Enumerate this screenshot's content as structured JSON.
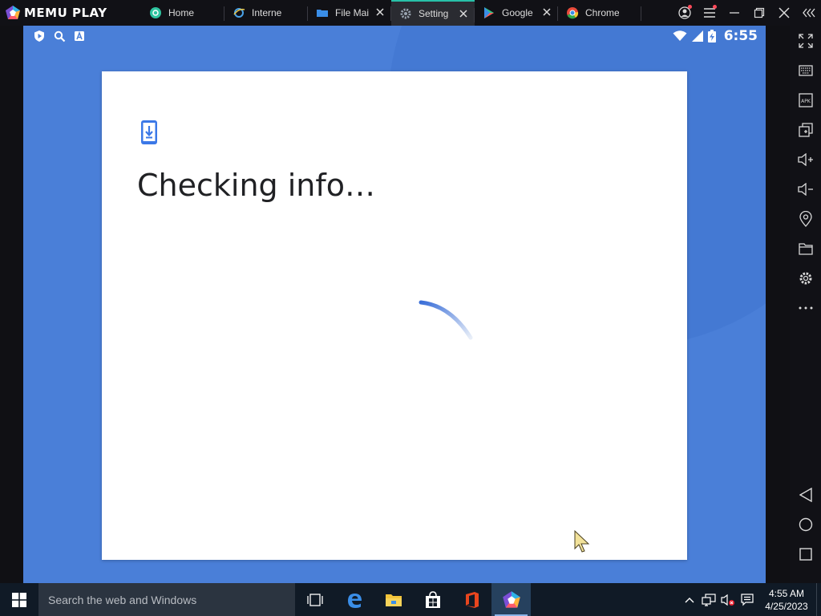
{
  "app": {
    "name": "MEMU PLAY"
  },
  "tabs": [
    {
      "label": "Home",
      "icon": "memu-home-icon",
      "active": false,
      "closable": false
    },
    {
      "label": "Interne",
      "icon": "internet-icon",
      "active": false,
      "closable": false
    },
    {
      "label": "File Mai",
      "icon": "folder-icon",
      "active": false,
      "closable": true
    },
    {
      "label": "Setting",
      "icon": "settings-icon",
      "active": true,
      "closable": true
    },
    {
      "label": "Google",
      "icon": "play-store-icon",
      "active": false,
      "closable": true
    },
    {
      "label": "Chrome",
      "icon": "chrome-icon",
      "active": false,
      "closable": false
    }
  ],
  "android": {
    "status_time": "6:55",
    "dialog": {
      "title": "Checking info…",
      "icon": "phone-download-icon"
    }
  },
  "taskbar": {
    "search_placeholder": "Search the web and Windows",
    "time": "4:55 AM",
    "date": "4/25/2023"
  },
  "colors": {
    "android_bg": "#4a7fd8",
    "accent_tab": "#28c0a8",
    "dialog_icon": "#3b78e7"
  }
}
